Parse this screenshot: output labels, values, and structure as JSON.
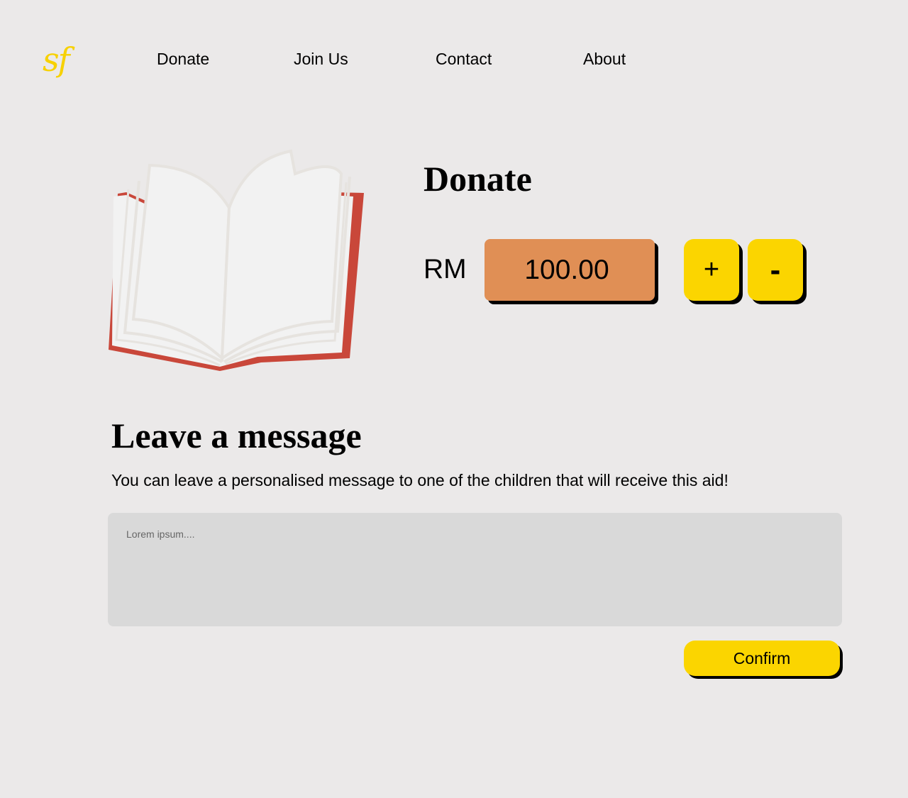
{
  "header": {
    "logo_text": "sf",
    "nav": [
      "Donate",
      "Join Us",
      "Contact",
      "About"
    ]
  },
  "donate": {
    "title": "Donate",
    "currency": "RM",
    "amount": "100.00",
    "plus_label": "+",
    "minus_label": "-"
  },
  "message": {
    "title": "Leave a message",
    "subtitle": "You can leave a personalised message to one of the children that will receive this aid!",
    "placeholder": "Lorem ipsum....",
    "confirm_label": "Confirm"
  },
  "colors": {
    "background": "#ebe9e9",
    "accent_yellow": "#fbd500",
    "amount_orange": "#e08f55",
    "book_red": "#c9473a",
    "textarea_gray": "#d9d9d9"
  },
  "icons": {
    "book": "open-book-illustration"
  }
}
